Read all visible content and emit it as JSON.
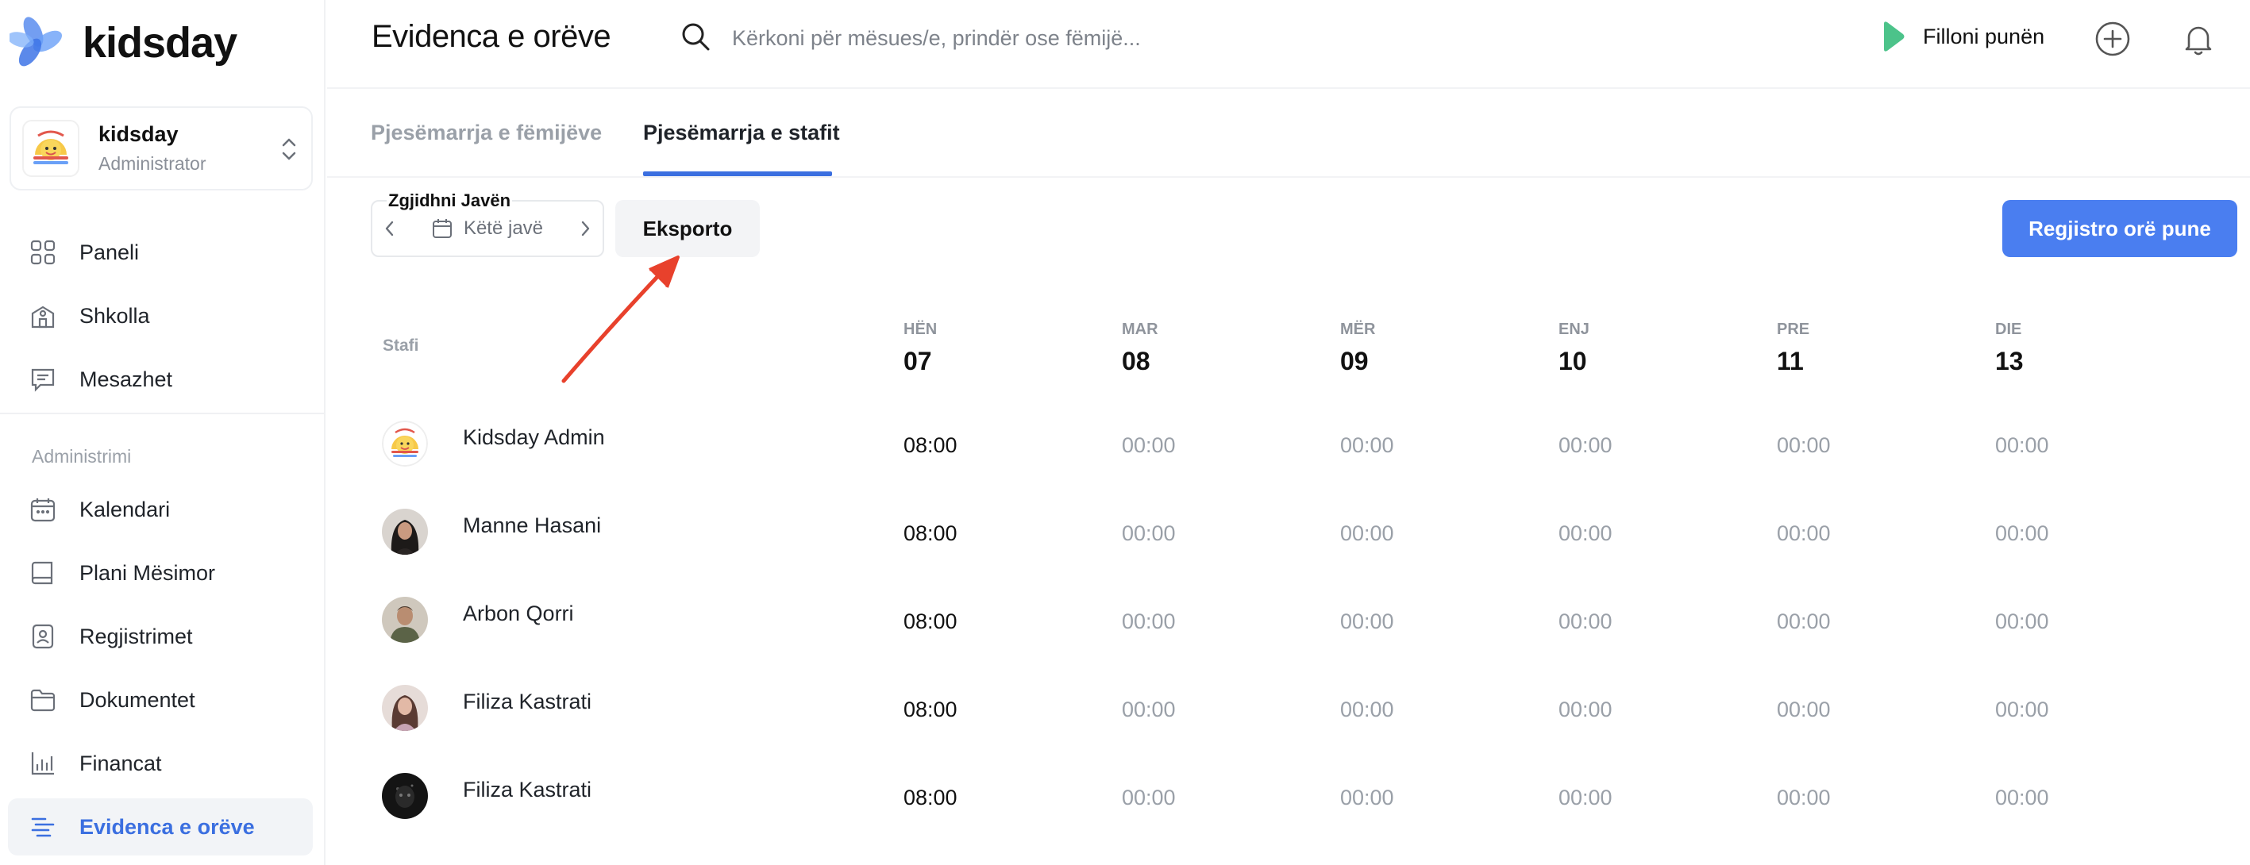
{
  "brand": {
    "name": "kidsday"
  },
  "org": {
    "name": "kidsday",
    "role": "Administrator"
  },
  "nav": {
    "main": [
      {
        "label": "Paneli",
        "icon": "grid-icon"
      },
      {
        "label": "Shkolla",
        "icon": "school-icon"
      },
      {
        "label": "Mesazhet",
        "icon": "message-icon"
      }
    ],
    "section_label": "Administrimi",
    "admin": [
      {
        "label": "Kalendari",
        "icon": "calendar-icon"
      },
      {
        "label": "Plani Mësimor",
        "icon": "book-icon"
      },
      {
        "label": "Regjistrimet",
        "icon": "id-card-icon"
      },
      {
        "label": "Dokumentet",
        "icon": "folder-icon"
      },
      {
        "label": "Financat",
        "icon": "chart-icon"
      },
      {
        "label": "Evidenca e orëve",
        "icon": "timeline-icon",
        "active": true
      }
    ]
  },
  "header": {
    "title": "Evidenca e orëve",
    "search_placeholder": "Kërkoni për mësues/e, prindër ose fëmijë...",
    "start_work": "Filloni punën"
  },
  "tabs": [
    {
      "label": "Pjesëmarrja e fëmijëve",
      "active": false
    },
    {
      "label": "Pjesëmarrja e stafit",
      "active": true
    }
  ],
  "toolbar": {
    "week_label": "Zgjidhni Javën",
    "week_value": "Këtë javë",
    "export_label": "Eksporto",
    "register_label": "Regjistro orë pune"
  },
  "table": {
    "staff_header": "Stafi",
    "days": [
      {
        "dow": "HËN",
        "num": "07"
      },
      {
        "dow": "MAR",
        "num": "08"
      },
      {
        "dow": "MËR",
        "num": "09"
      },
      {
        "dow": "ENJ",
        "num": "10"
      },
      {
        "dow": "PRE",
        "num": "11"
      },
      {
        "dow": "DIE",
        "num": "13"
      }
    ],
    "rows": [
      {
        "name": "Kidsday Admin",
        "hours": [
          "08:00",
          "00:00",
          "00:00",
          "00:00",
          "00:00",
          "00:00"
        ]
      },
      {
        "name": "Manne Hasani",
        "hours": [
          "08:00",
          "00:00",
          "00:00",
          "00:00",
          "00:00",
          "00:00"
        ]
      },
      {
        "name": "Arbon Qorri",
        "hours": [
          "08:00",
          "00:00",
          "00:00",
          "00:00",
          "00:00",
          "00:00"
        ]
      },
      {
        "name": "Filiza Kastrati",
        "hours": [
          "08:00",
          "00:00",
          "00:00",
          "00:00",
          "00:00",
          "00:00"
        ]
      },
      {
        "name": "Filiza Kastrati",
        "hours": [
          "08:00",
          "00:00",
          "00:00",
          "00:00",
          "00:00",
          "00:00"
        ]
      }
    ]
  },
  "colors": {
    "accent": "#3b6fe0",
    "button": "#4a7ef0",
    "play": "#4cc38a",
    "arrow": "#e8412c"
  }
}
